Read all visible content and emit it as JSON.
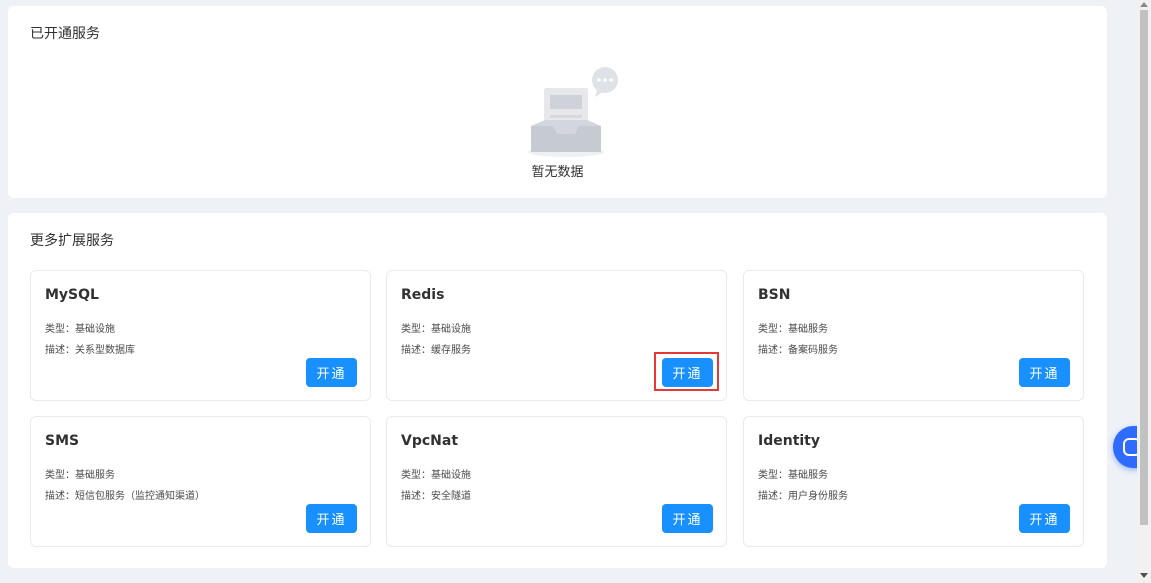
{
  "active_services": {
    "title": "已开通服务",
    "empty_text": "暂无数据"
  },
  "more_services": {
    "title": "更多扩展服务",
    "cards": [
      {
        "name": "MySQL",
        "type": "类型：基础设施",
        "desc": "描述：关系型数据库",
        "button": "开通"
      },
      {
        "name": "Redis",
        "type": "类型：基础设施",
        "desc": "描述：缓存服务",
        "button": "开通"
      },
      {
        "name": "BSN",
        "type": "类型：基础服务",
        "desc": "描述：备案码服务",
        "button": "开通"
      },
      {
        "name": "SMS",
        "type": "类型：基础服务",
        "desc": "描述：短信包服务（监控通知渠道）",
        "button": "开通"
      },
      {
        "name": "VpcNat",
        "type": "类型：基础设施",
        "desc": "描述：安全隧道",
        "button": "开通"
      },
      {
        "name": "Identity",
        "type": "类型：基础服务",
        "desc": "描述：用户身份服务",
        "button": "开通"
      }
    ]
  },
  "colors": {
    "primary": "#1890ff",
    "highlight": "#e53935",
    "background": "#eef1f6"
  }
}
